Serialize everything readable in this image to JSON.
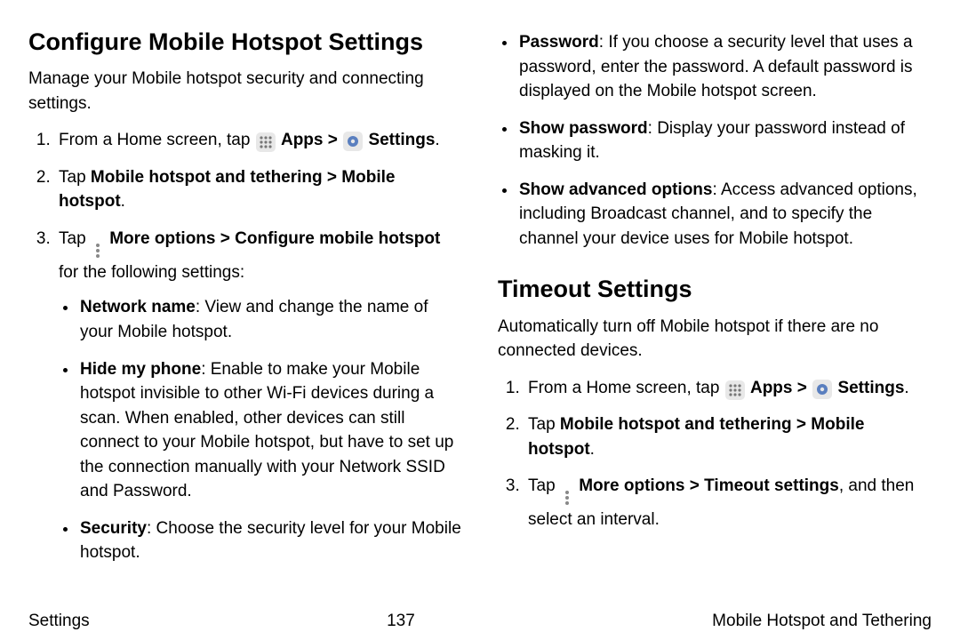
{
  "left": {
    "heading": "Configure Mobile Hotspot Settings",
    "intro": "Manage your Mobile hotspot security and connecting settings.",
    "step1_pre": "From a Home screen, tap ",
    "apps_label": "Apps",
    "settings_label": "Settings",
    "step2_pre": "Tap ",
    "step2_b1": "Mobile hotspot and tethering",
    "step2_b2": "Mobile hotspot",
    "step3_pre": "Tap ",
    "step3_b": "More options",
    "step3_b2": "Configure mobile hotspot",
    "step3_post": " for the following settings:",
    "bullets": {
      "net_name_t": "Network name",
      "net_name_d": ": View and change the name of your Mobile hotspot.",
      "hide_t": "Hide my phone",
      "hide_d": ": Enable to make your Mobile hotspot invisible to other Wi-Fi devices during a scan. When enabled, other devices can still connect to your Mobile hotspot, but have to set up the connection manually with your Network SSID and Password.",
      "sec_t": "Security",
      "sec_d": ": Choose the security level for your Mobile hotspot."
    }
  },
  "right": {
    "bullets": {
      "pwd_t": "Password",
      "pwd_d": ": If you choose a security level that uses a password, enter the password. A default password is displayed on the Mobile hotspot screen.",
      "show_t": "Show password",
      "show_d": ": Display your password instead of masking it.",
      "adv_t": "Show advanced options",
      "adv_d": ": Access advanced options, including Broadcast channel, and to specify the channel your device uses for Mobile hotspot."
    },
    "heading2": "Timeout Settings",
    "intro2": "Automatically turn off Mobile hotspot if there are no connected devices.",
    "step1_pre": "From a Home screen, tap ",
    "apps_label": "Apps",
    "settings_label": "Settings",
    "step2_pre": "Tap ",
    "step2_b1": "Mobile hotspot and tethering",
    "step2_b2": "Mobile hotspot",
    "step3_pre": "Tap ",
    "step3_b": "More options",
    "step3_b2": "Timeout settings",
    "step3_post": ", and then select an interval."
  },
  "footer": {
    "left": "Settings",
    "center": "137",
    "right": "Mobile Hotspot and Tethering"
  },
  "chev": ">",
  "period": "."
}
